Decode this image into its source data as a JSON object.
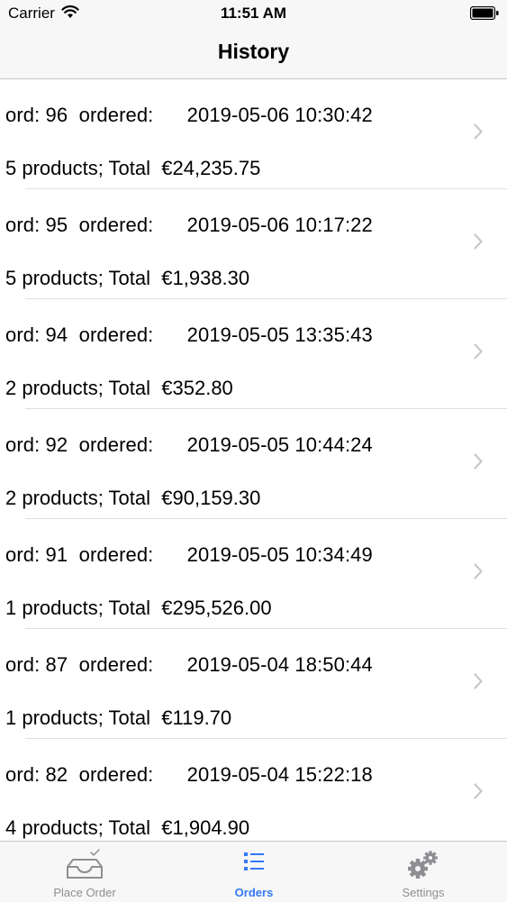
{
  "status_bar": {
    "carrier": "Carrier",
    "time": "11:51 AM"
  },
  "nav": {
    "title": "History"
  },
  "orders": [
    {
      "id_text": "ord: 96",
      "ordered_text": "ordered:",
      "datetime": "2019-05-06 10:30:42",
      "products": "5 products; Total",
      "total": "€24,235.75"
    },
    {
      "id_text": "ord: 95",
      "ordered_text": "ordered:",
      "datetime": "2019-05-06 10:17:22",
      "products": "5 products; Total",
      "total": "€1,938.30"
    },
    {
      "id_text": "ord: 94",
      "ordered_text": "ordered:",
      "datetime": "2019-05-05 13:35:43",
      "products": "2 products; Total",
      "total": "€352.80"
    },
    {
      "id_text": "ord: 92",
      "ordered_text": "ordered:",
      "datetime": "2019-05-05 10:44:24",
      "products": "2 products; Total",
      "total": "€90,159.30"
    },
    {
      "id_text": "ord: 91",
      "ordered_text": "ordered:",
      "datetime": "2019-05-05 10:34:49",
      "products": "1 products; Total",
      "total": "€295,526.00"
    },
    {
      "id_text": "ord: 87",
      "ordered_text": "ordered:",
      "datetime": "2019-05-04 18:50:44",
      "products": "1 products; Total",
      "total": "€119.70"
    },
    {
      "id_text": "ord: 82",
      "ordered_text": "ordered:",
      "datetime": "2019-05-04 15:22:18",
      "products": "4 products; Total",
      "total": "€1,904.90"
    }
  ],
  "tabs": [
    {
      "label": "Place Order",
      "icon": "inbox-check-icon",
      "active": false
    },
    {
      "label": "Orders",
      "icon": "list-icon",
      "active": true
    },
    {
      "label": "Settings",
      "icon": "gear-icon",
      "active": false
    }
  ],
  "colors": {
    "accent": "#3478f6",
    "inactive": "#8e8e93",
    "bar_bg": "#f7f7f7",
    "separator": "#c8c7cc"
  }
}
